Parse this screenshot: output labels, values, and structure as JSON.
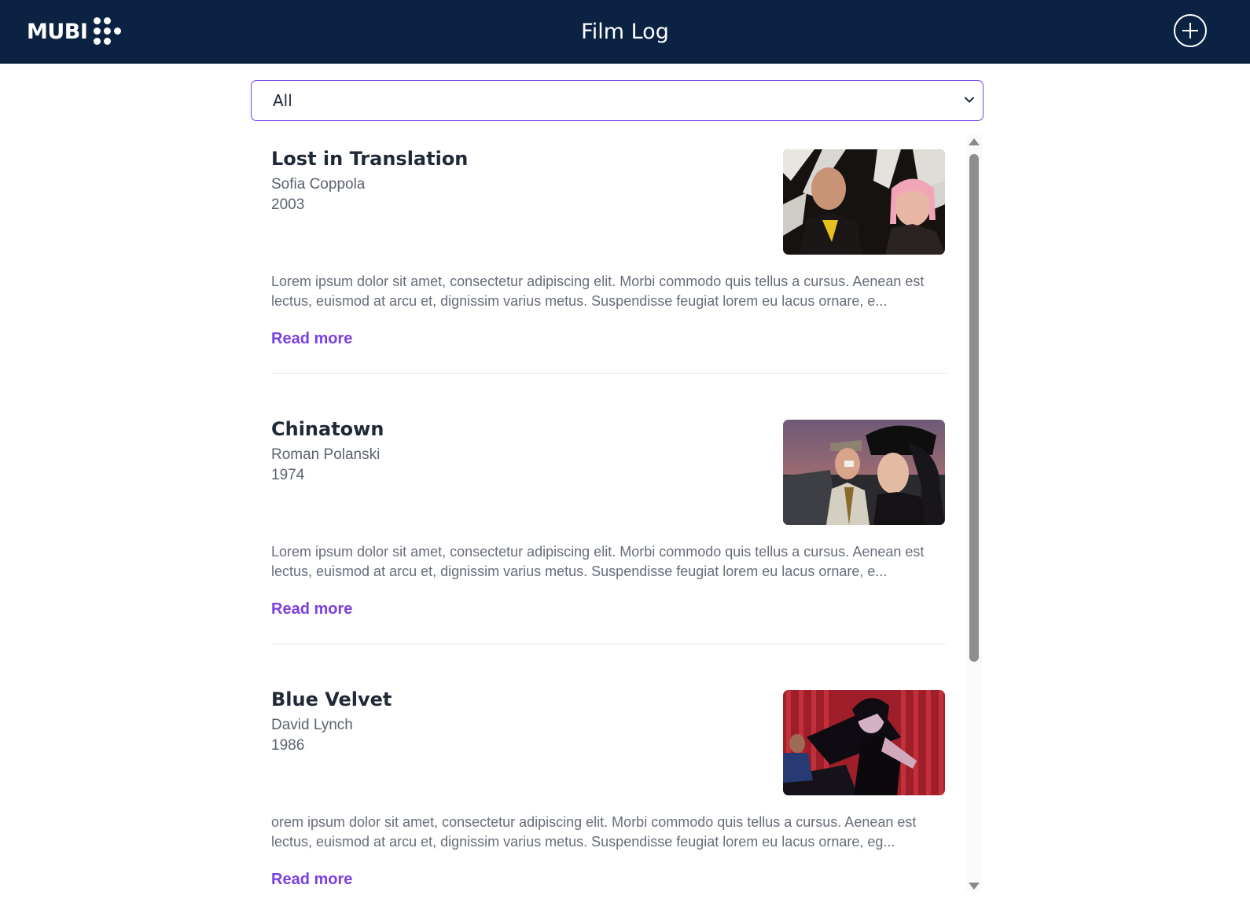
{
  "header": {
    "logo_text": "MUBI",
    "title": "Film Log",
    "add_icon": "plus-circle-icon",
    "background": "#0b2243"
  },
  "filter": {
    "selected": "All",
    "icon": "chevron-down-icon",
    "accent": "#7b3fe4"
  },
  "films": [
    {
      "title": "Lost in Translation",
      "director": "Sofia Coppola",
      "year": "2003",
      "description": "Lorem ipsum dolor sit amet, consectetur adipiscing elit. Morbi commodo quis tellus a cursus. Aenean est lectus, euismod at arcu et, dignissim varius metus. Suspendisse feugiat lorem eu lacus ornare, e...",
      "read_more": "Read more"
    },
    {
      "title": "Chinatown",
      "director": "Roman Polanski",
      "year": "1974",
      "description": "Lorem ipsum dolor sit amet, consectetur adipiscing elit. Morbi commodo quis tellus a cursus. Aenean est lectus, euismod at arcu et, dignissim varius metus. Suspendisse feugiat lorem eu lacus ornare, e...",
      "read_more": "Read more"
    },
    {
      "title": "Blue Velvet",
      "director": "David Lynch",
      "year": "1986",
      "description": "orem ipsum dolor sit amet, consectetur adipiscing elit. Morbi commodo quis tellus a cursus. Aenean est lectus, euismod at arcu et, dignissim varius metus. Suspendisse feugiat lorem eu lacus ornare, eg...",
      "read_more": "Read more"
    }
  ],
  "colors": {
    "link": "#7b3fe4",
    "title_text": "#1f2937",
    "meta_text": "#5b6270"
  }
}
